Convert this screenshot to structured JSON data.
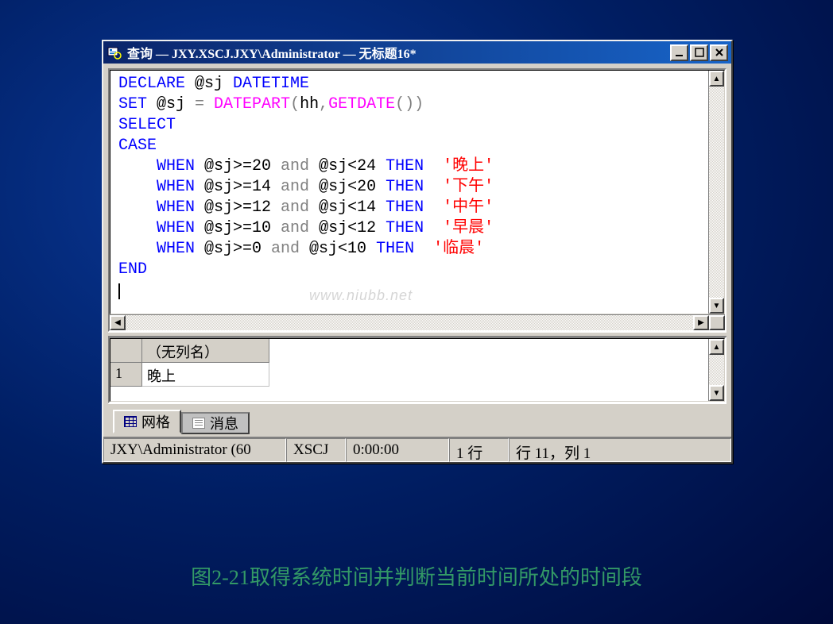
{
  "window": {
    "title": "查询 — JXY.XSCJ.JXY\\Administrator — 无标题16*"
  },
  "code": {
    "line1_kw1": "DECLARE",
    "line1_var": " @sj ",
    "line1_kw2": "DATETIME",
    "line2_kw": "SET",
    "line2_var": " @sj ",
    "line2_op": "=",
    "line2_fn1": " DATEPART",
    "line2_paren1": "(",
    "line2_arg": "hh",
    "line2_comma": ",",
    "line2_fn2": "GETDATE",
    "line2_paren2": "())",
    "line3": "SELECT",
    "line4": "CASE",
    "when1_kw": "    WHEN",
    "when1_cond": " @sj>=20 ",
    "when1_and": "and",
    "when1_cond2": " @sj<24 ",
    "when1_then": "THEN",
    "when1_sp": "  ",
    "when1_str": "'晚上'",
    "when2_kw": "    WHEN",
    "when2_cond": " @sj>=14 ",
    "when2_and": "and",
    "when2_cond2": " @sj<20 ",
    "when2_then": "THEN",
    "when2_sp": "  ",
    "when2_str": "'下午'",
    "when3_kw": "    WHEN",
    "when3_cond": " @sj>=12 ",
    "when3_and": "and",
    "when3_cond2": " @sj<14 ",
    "when3_then": "THEN",
    "when3_sp": "  ",
    "when3_str": "'中午'",
    "when4_kw": "    WHEN",
    "when4_cond": " @sj>=10 ",
    "when4_and": "and",
    "when4_cond2": " @sj<12 ",
    "when4_then": "THEN",
    "when4_sp": "  ",
    "when4_str": "'早晨'",
    "when5_kw": "    WHEN",
    "when5_cond": " @sj>=0 ",
    "when5_and": "and",
    "when5_cond2": " @sj<10 ",
    "when5_then": "THEN",
    "when5_sp": "  ",
    "when5_str": "'临晨'",
    "end": "END"
  },
  "watermark": "www.niubb.net",
  "results": {
    "column_header": "（无列名）",
    "row_num": "1",
    "cell_value": "晚上"
  },
  "tabs": {
    "grid": "网格",
    "messages": "消息"
  },
  "status": {
    "conn": "JXY\\Administrator (60",
    "db": "XSCJ",
    "time": "0:00:00",
    "rows": "1 行",
    "pos": "行 11，列 1"
  },
  "caption": "图2-21取得系统时间并判断当前时间所处的时间段"
}
